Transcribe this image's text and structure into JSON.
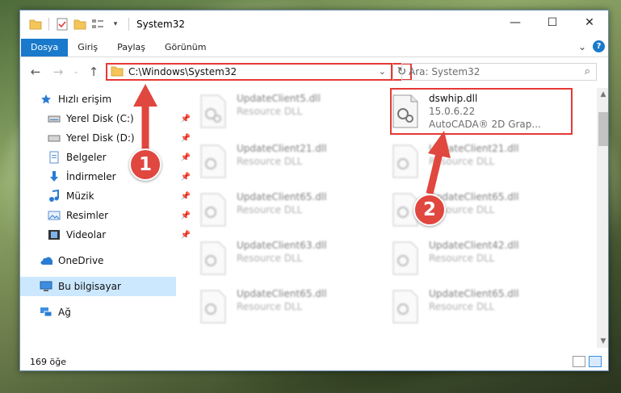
{
  "window": {
    "title": "System32"
  },
  "window_controls": {
    "minimize": "—",
    "maximize": "☐",
    "close": "✕"
  },
  "ribbon": {
    "tabs": [
      "Dosya",
      "Giriş",
      "Paylaş",
      "Görünüm"
    ],
    "expand_glyph": "⌄",
    "help_glyph": "?"
  },
  "address_bar": {
    "path": "C:\\Windows\\System32",
    "dropdown_glyph": "⌄",
    "refresh_glyph": "↻"
  },
  "search": {
    "placeholder": "Ara: System32",
    "icon": "search-icon"
  },
  "sidebar": {
    "items": [
      {
        "label": "Hızlı erişim",
        "icon": "star-icon",
        "pinned": false
      },
      {
        "label": "Yerel Disk (C:)",
        "icon": "drive-icon",
        "pinned": true
      },
      {
        "label": "Yerel Disk (D:)",
        "icon": "drive-icon",
        "pinned": true
      },
      {
        "label": "Belgeler",
        "icon": "documents-icon",
        "pinned": true
      },
      {
        "label": "İndirmeler",
        "icon": "download-icon",
        "pinned": true
      },
      {
        "label": "Müzik",
        "icon": "music-icon",
        "pinned": true
      },
      {
        "label": "Resimler",
        "icon": "pictures-icon",
        "pinned": true
      },
      {
        "label": "Videolar",
        "icon": "videos-icon",
        "pinned": true
      },
      {
        "label": "OneDrive",
        "icon": "cloud-icon",
        "pinned": false
      },
      {
        "label": "Bu bilgisayar",
        "icon": "computer-icon",
        "pinned": false,
        "selected": true
      },
      {
        "label": "Ağ",
        "icon": "network-icon",
        "pinned": false
      }
    ]
  },
  "files": [
    {
      "name": "UpdateClient5.dll",
      "sub": "Resource DLL",
      "blurred": true
    },
    {
      "name": "dswhip.dll",
      "sub": "15.0.6.22",
      "sub2": "AutoCADA® 2D Grap...",
      "blurred": false,
      "highlighted": true
    },
    {
      "name": "UpdateClient21.dll",
      "sub": "Resource DLL",
      "blurred": true
    },
    {
      "name": "UpdateClient21.dll",
      "sub": "Resource DLL",
      "blurred": true
    },
    {
      "name": "UpdateClient65.dll",
      "sub": "Resource DLL",
      "blurred": true
    },
    {
      "name": "UpdateClient65.dll",
      "sub": "Resource DLL",
      "blurred": true
    },
    {
      "name": "UpdateClient63.dll",
      "sub": "Resource DLL",
      "blurred": true
    },
    {
      "name": "UpdateClient42.dll",
      "sub": "Resource DLL",
      "blurred": true
    },
    {
      "name": "UpdateClient65.dll",
      "sub": "Resource DLL",
      "blurred": true
    },
    {
      "name": "UpdateClient65.dll",
      "sub": "Resource DLL",
      "blurred": true
    }
  ],
  "status": {
    "item_count": "169 öğe"
  },
  "callouts": [
    {
      "number": "1"
    },
    {
      "number": "2"
    }
  ],
  "colors": {
    "accent": "#1979ca",
    "highlight": "#e53935",
    "selection": "#cce8ff"
  }
}
